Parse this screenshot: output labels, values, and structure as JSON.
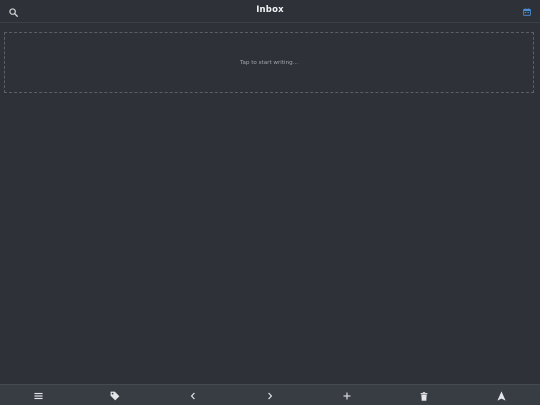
{
  "header": {
    "title": "Inbox",
    "left_icon": "search-icon",
    "right_icon": "calendar-icon",
    "accent_color": "#4a90d9"
  },
  "composer": {
    "placeholder": "Tap to start writing..."
  },
  "toolbar": {
    "items": [
      {
        "icon": "menu-icon"
      },
      {
        "icon": "tag-icon"
      },
      {
        "icon": "chevron-left-icon"
      },
      {
        "icon": "chevron-right-icon"
      },
      {
        "icon": "plus-icon"
      },
      {
        "icon": "trash-icon"
      },
      {
        "icon": "send-icon"
      }
    ]
  }
}
